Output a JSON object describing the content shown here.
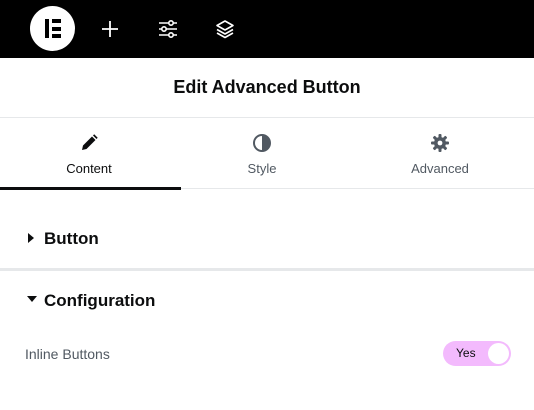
{
  "topbar": {
    "logo_icon": "elementor-logo-icon",
    "buttons": [
      {
        "icon": "plus-icon",
        "name": "add-element-button"
      },
      {
        "icon": "sliders-icon",
        "name": "site-settings-button"
      },
      {
        "icon": "layers-icon",
        "name": "structure-button"
      }
    ],
    "background": "#000000"
  },
  "panel": {
    "title": "Edit Advanced Button"
  },
  "tabs": [
    {
      "label": "Content",
      "icon": "pencil-icon",
      "active": true
    },
    {
      "label": "Style",
      "icon": "half-circle-icon",
      "active": false
    },
    {
      "label": "Advanced",
      "icon": "gear-icon",
      "active": false
    }
  ],
  "sections": [
    {
      "label": "Button",
      "expanded": false
    },
    {
      "label": "Configuration",
      "expanded": true
    }
  ],
  "controls": {
    "inline_buttons": {
      "label": "Inline Buttons",
      "value": "Yes",
      "on": true
    }
  },
  "colors": {
    "accent_switch": "#f3bafd",
    "text_primary": "#0c0d0e",
    "text_secondary": "#515962"
  }
}
